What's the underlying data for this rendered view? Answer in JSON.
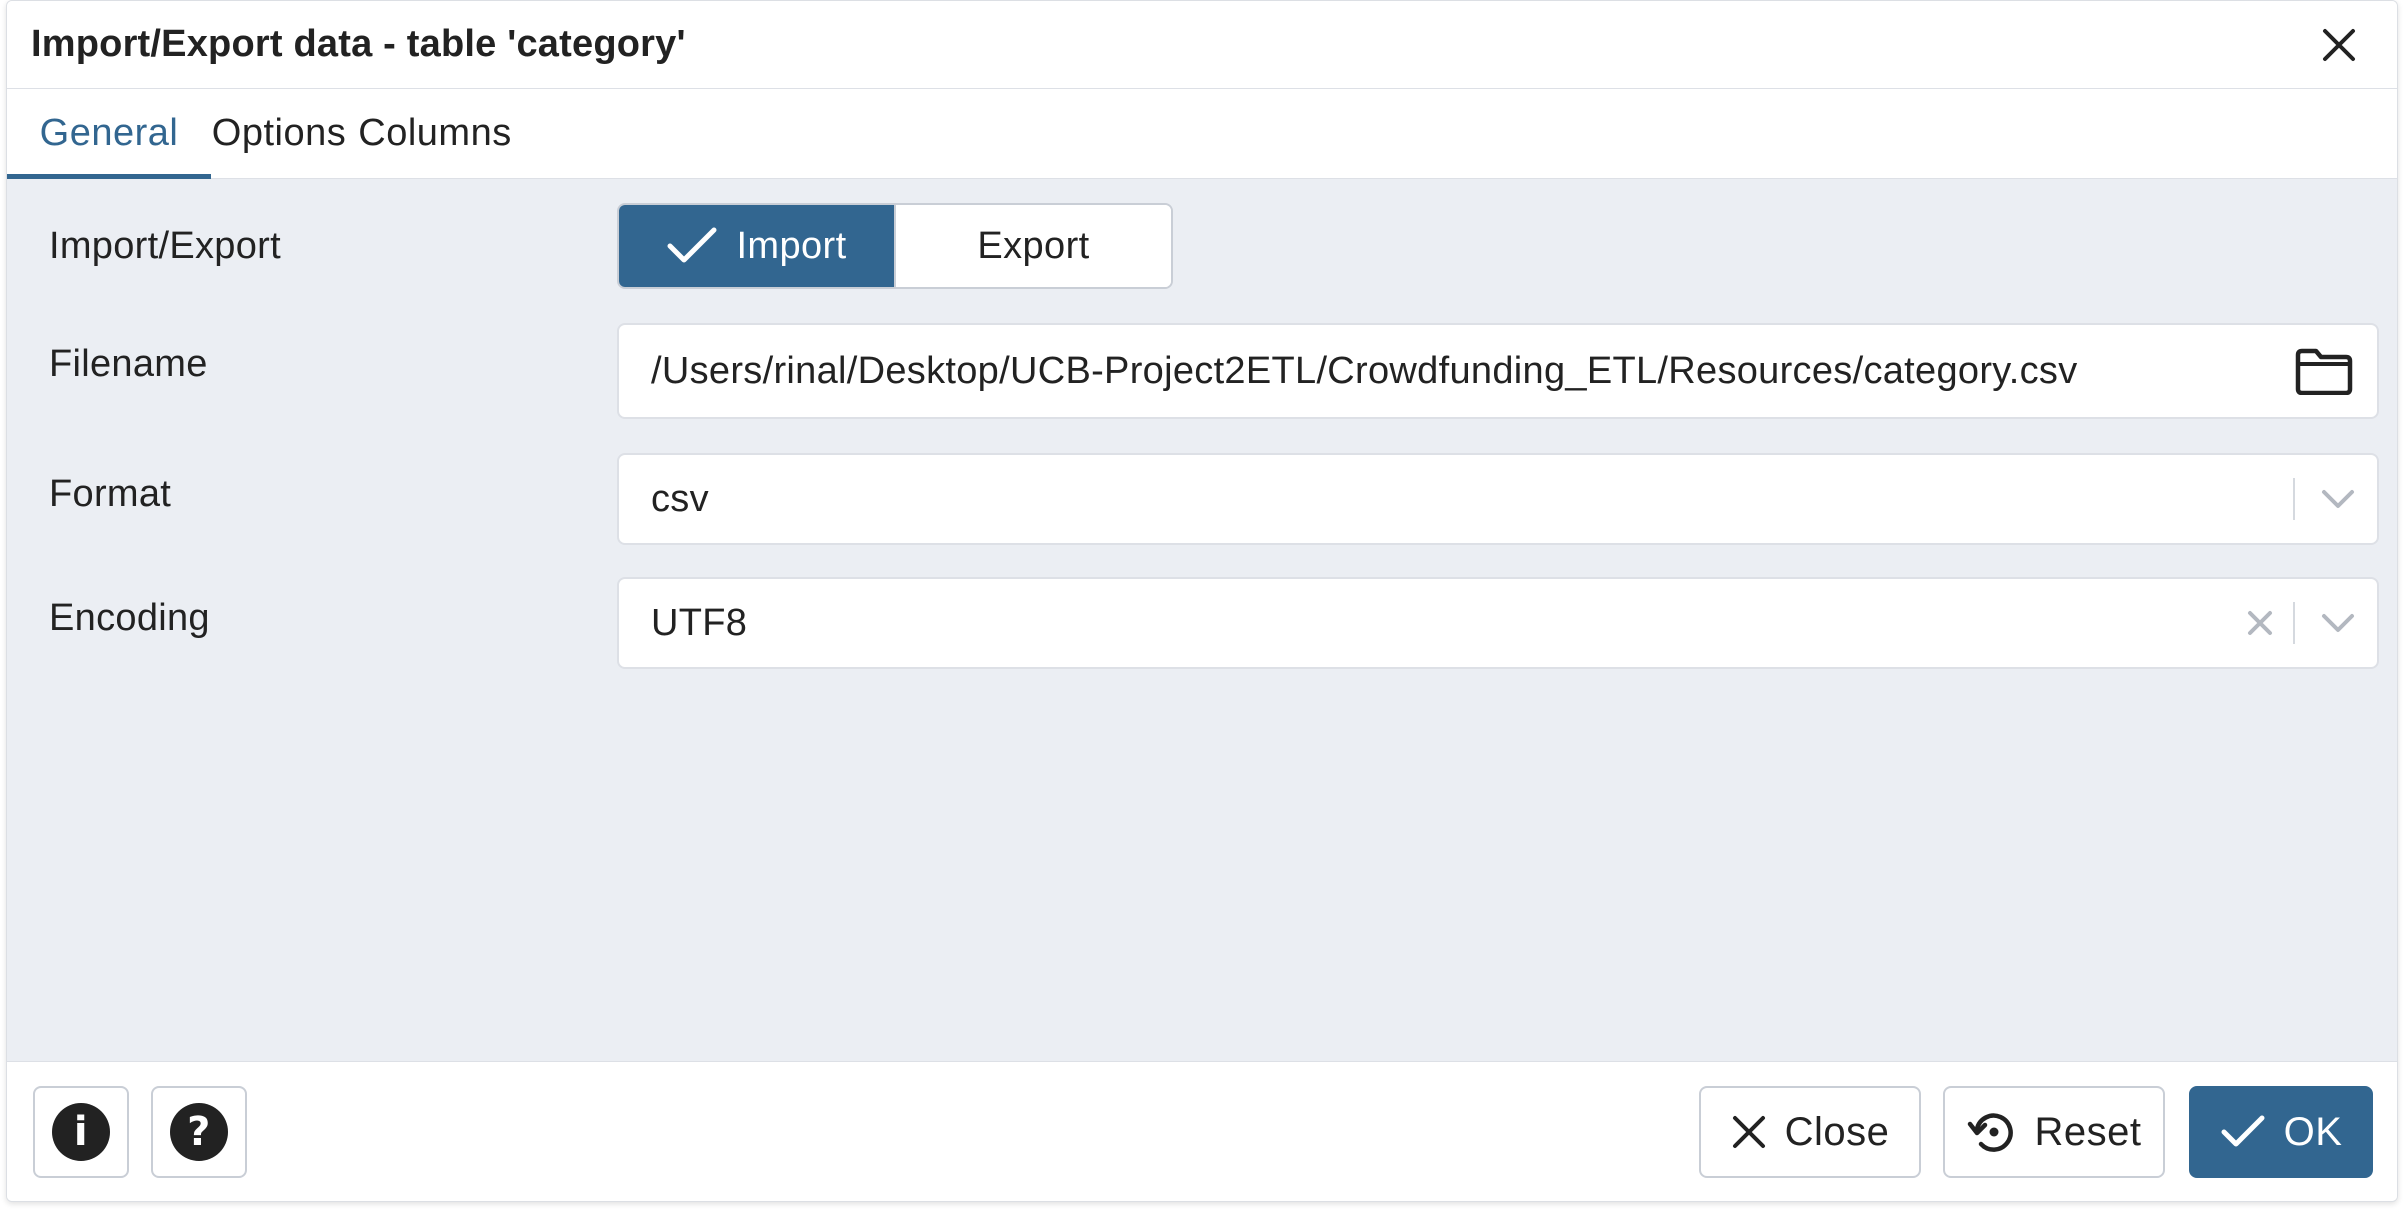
{
  "dialog": {
    "title": "Import/Export data - table 'category'"
  },
  "tabs": [
    {
      "label": "General",
      "active": true
    },
    {
      "label": "Options",
      "active": false
    },
    {
      "label": "Columns",
      "active": false
    }
  ],
  "general": {
    "import_export": {
      "label": "Import/Export",
      "import_label": "Import",
      "export_label": "Export",
      "selected": "Import"
    },
    "filename": {
      "label": "Filename",
      "value": "/Users/rinal/Desktop/UCB-Project2ETL/Crowdfunding_ETL/Resources/category.csv",
      "icon": "folder-icon"
    },
    "format": {
      "label": "Format",
      "value": "csv"
    },
    "encoding": {
      "label": "Encoding",
      "value": "UTF8"
    }
  },
  "footer": {
    "info_glyph": "i",
    "help_glyph": "?",
    "close_label": "Close",
    "reset_label": "Reset",
    "ok_label": "OK"
  },
  "colors": {
    "accent": "#326690",
    "body_bg": "#ebeef3",
    "border": "#dde0e6"
  }
}
